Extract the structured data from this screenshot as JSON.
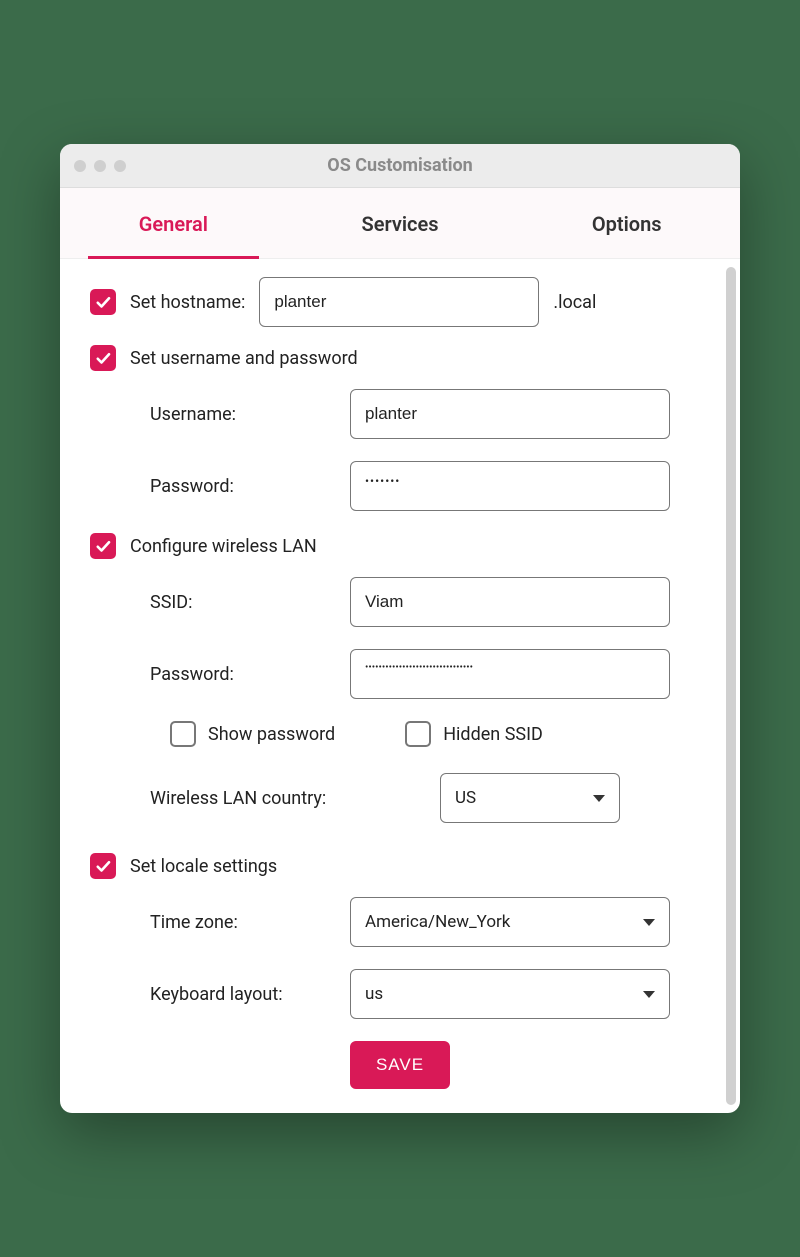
{
  "window": {
    "title": "OS Customisation"
  },
  "tabs": {
    "general": "General",
    "services": "Services",
    "options": "Options",
    "active": "general"
  },
  "hostname": {
    "checkbox_label": "Set hostname:",
    "value": "planter",
    "suffix": ".local",
    "checked": true
  },
  "userpass": {
    "checkbox_label": "Set username and password",
    "checked": true,
    "username_label": "Username:",
    "username_value": "planter",
    "password_label": "Password:",
    "password_mask": "•••••••"
  },
  "wlan": {
    "checkbox_label": "Configure wireless LAN",
    "checked": true,
    "ssid_label": "SSID:",
    "ssid_value": "Viam",
    "password_label": "Password:",
    "password_mask": "••••••••••••••••••••••••••••••••",
    "show_password_label": "Show password",
    "show_password_checked": false,
    "hidden_ssid_label": "Hidden SSID",
    "hidden_ssid_checked": false,
    "country_label": "Wireless LAN country:",
    "country_value": "US"
  },
  "locale": {
    "checkbox_label": "Set locale settings",
    "checked": true,
    "timezone_label": "Time zone:",
    "timezone_value": "America/New_York",
    "keyboard_label": "Keyboard layout:",
    "keyboard_value": "us"
  },
  "buttons": {
    "save": "SAVE"
  }
}
